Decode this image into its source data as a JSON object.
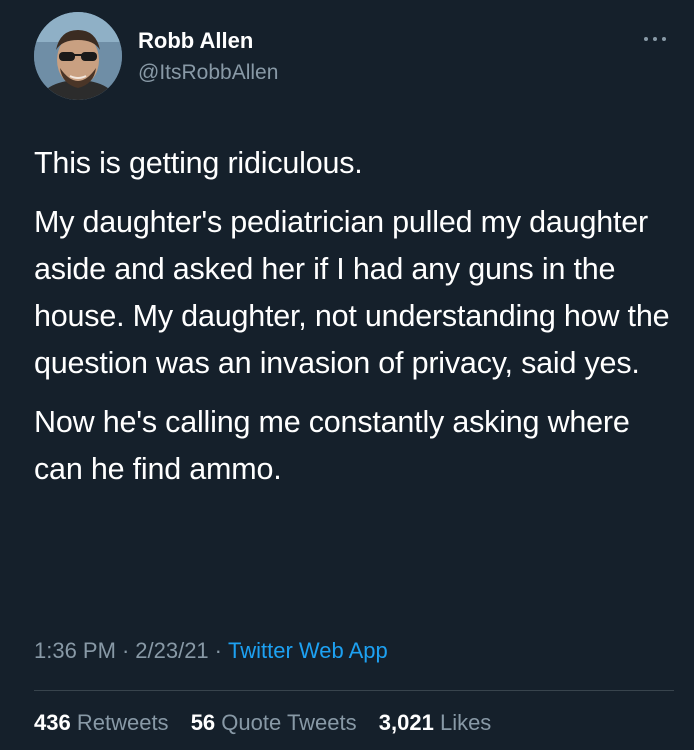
{
  "author": {
    "display_name": "Robb Allen",
    "handle": "@ItsRobbAllen",
    "avatar_icon": "profile-photo-avatar"
  },
  "menu": {
    "more_icon": "more-options-icon"
  },
  "tweet": {
    "paragraphs": [
      "This is getting ridiculous.",
      "My daughter's pediatrician pulled my daughter aside and asked her if I had any guns in the house. My daughter, not understanding how the question was an invasion of privacy, said yes.",
      "Now he's calling me constantly asking where can he find ammo."
    ],
    "time": "1:36 PM",
    "date": "2/23/21",
    "separator": "·",
    "source": "Twitter Web App"
  },
  "stats": {
    "retweets_count": "436",
    "retweets_label": "Retweets",
    "quotes_count": "56",
    "quotes_label": "Quote Tweets",
    "likes_count": "3,021",
    "likes_label": "Likes"
  },
  "colors": {
    "background": "#15202b",
    "text": "#ffffff",
    "secondary_text": "#8899a6",
    "link": "#1da1f2",
    "divider": "#38444d"
  }
}
